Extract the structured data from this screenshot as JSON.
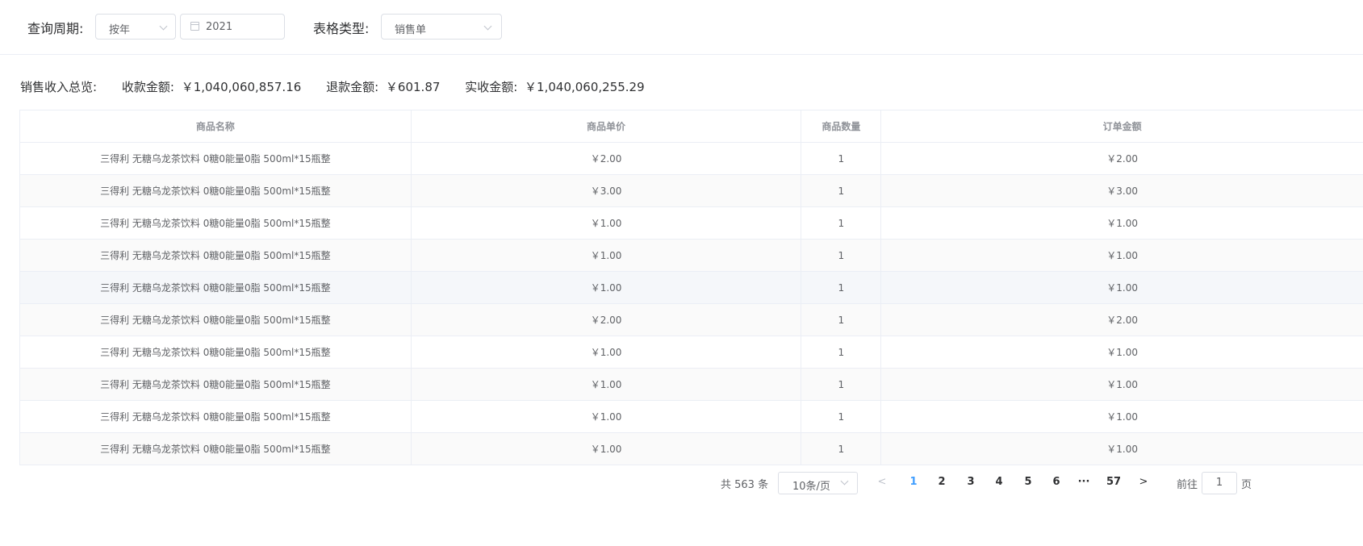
{
  "filters": {
    "period_label": "查询周期:",
    "period_select": "按年",
    "year_value": "2021",
    "type_label": "表格类型:",
    "type_select": "销售单"
  },
  "summary": {
    "title": "销售收入总览:",
    "received_label": "收款金额:",
    "received_value": "￥1,040,060,857.16",
    "refund_label": "退款金额:",
    "refund_value": "￥601.87",
    "actual_label": "实收金额:",
    "actual_value": "￥1,040,060,255.29"
  },
  "table": {
    "headers": [
      "商品名称",
      "商品单价",
      "商品数量",
      "订单金额"
    ],
    "rows": [
      [
        "三得利 无糖乌龙茶饮料 0糖0能量0脂 500ml*15瓶整",
        "￥2.00",
        "1",
        "￥2.00"
      ],
      [
        "三得利 无糖乌龙茶饮料 0糖0能量0脂 500ml*15瓶整",
        "￥3.00",
        "1",
        "￥3.00"
      ],
      [
        "三得利 无糖乌龙茶饮料 0糖0能量0脂 500ml*15瓶整",
        "￥1.00",
        "1",
        "￥1.00"
      ],
      [
        "三得利 无糖乌龙茶饮料 0糖0能量0脂 500ml*15瓶整",
        "￥1.00",
        "1",
        "￥1.00"
      ],
      [
        "三得利 无糖乌龙茶饮料 0糖0能量0脂 500ml*15瓶整",
        "￥1.00",
        "1",
        "￥1.00"
      ],
      [
        "三得利 无糖乌龙茶饮料 0糖0能量0脂 500ml*15瓶整",
        "￥2.00",
        "1",
        "￥2.00"
      ],
      [
        "三得利 无糖乌龙茶饮料 0糖0能量0脂 500ml*15瓶整",
        "￥1.00",
        "1",
        "￥1.00"
      ],
      [
        "三得利 无糖乌龙茶饮料 0糖0能量0脂 500ml*15瓶整",
        "￥1.00",
        "1",
        "￥1.00"
      ],
      [
        "三得利 无糖乌龙茶饮料 0糖0能量0脂 500ml*15瓶整",
        "￥1.00",
        "1",
        "￥1.00"
      ],
      [
        "三得利 无糖乌龙茶饮料 0糖0能量0脂 500ml*15瓶整",
        "￥1.00",
        "1",
        "￥1.00"
      ]
    ]
  },
  "pagination": {
    "total": "共 563 条",
    "page_size": "10条/页",
    "prev": "<",
    "pages": [
      "1",
      "2",
      "3",
      "4",
      "5",
      "6"
    ],
    "ellipsis": "···",
    "last": "57",
    "next": ">",
    "current": "1",
    "goto_label": "前往",
    "goto_value": "1",
    "goto_suffix": "页"
  },
  "colors": {
    "active_page": "#409eff",
    "border": "#ebeef5",
    "stripe": "#fafafa"
  }
}
